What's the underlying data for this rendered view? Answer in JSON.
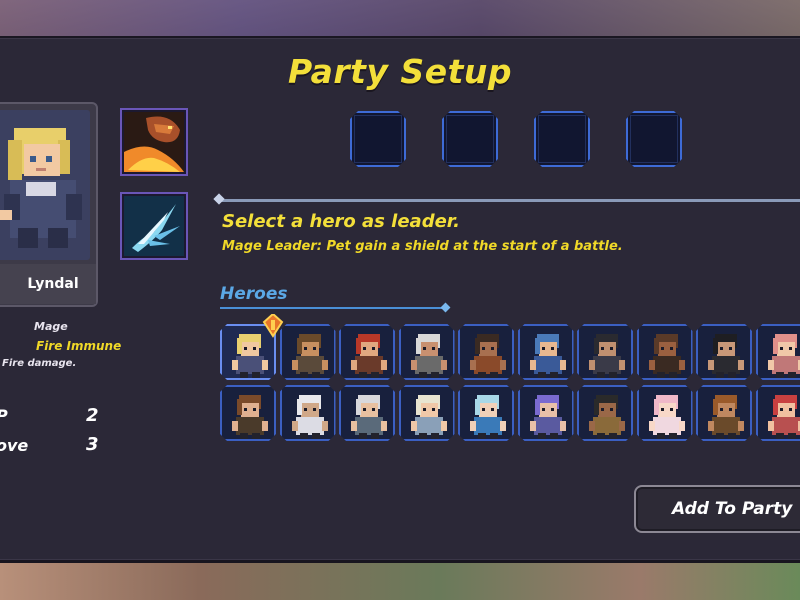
{
  "screen": {
    "title": "Party Setup"
  },
  "selected_hero": {
    "name": "Lyndal",
    "class": "Mage",
    "trait": "Fire Immune",
    "trait_desc": "Fire damage.",
    "stats": [
      {
        "label": "P",
        "value": "2"
      },
      {
        "label": "ove",
        "value": "3"
      }
    ],
    "skills": [
      "dragon-fire-breath-icon",
      "ice-claw-icon"
    ]
  },
  "party": {
    "slots": 4
  },
  "leader": {
    "prompt": "Select a hero as leader.",
    "bonus": "Mage Leader: Pet gain a shield at the start of a battle."
  },
  "heroes": {
    "label": "Heroes",
    "rows": [
      [
        {
          "hair": "#e8d070",
          "skin": "#f0c8a0",
          "body": "#4a5078"
        },
        {
          "hair": "#6a4a2a",
          "skin": "#c89060",
          "body": "#5a4a3a"
        },
        {
          "hair": "#b83828",
          "skin": "#e0a880",
          "body": "#6a3a2a"
        },
        {
          "hair": "#d8d8d8",
          "skin": "#c89070",
          "body": "#6a6a6a"
        },
        {
          "hair": "#3a2a22",
          "skin": "#a87050",
          "body": "#8a4a2a"
        },
        {
          "hair": "#4a7ab8",
          "skin": "#e8b890",
          "body": "#3a5a98"
        },
        {
          "hair": "#2a2a30",
          "skin": "#c09070",
          "body": "#3a3a48"
        },
        {
          "hair": "#5a3a28",
          "skin": "#9a6040",
          "body": "#3a2a22"
        },
        {
          "hair": "#1e1e22",
          "skin": "#c89878",
          "body": "#2a2a30"
        },
        {
          "hair": "#e0908a",
          "skin": "#f0c8a8",
          "body": "#c07878"
        }
      ],
      [
        {
          "hair": "#7a4a2a",
          "skin": "#e0b090",
          "body": "#4a3a2a"
        },
        {
          "hair": "#e8e8ec",
          "skin": "#d0a888",
          "body": "#dcdce4"
        },
        {
          "hair": "#d8d8dc",
          "skin": "#e8c0a0",
          "body": "#5a6a7a"
        },
        {
          "hair": "#e8e4d0",
          "skin": "#f0c8a8",
          "body": "#8aa0b8"
        },
        {
          "hair": "#a8d8e8",
          "skin": "#f0d0b8",
          "body": "#3a7ab8"
        },
        {
          "hair": "#7a6ad0",
          "skin": "#e8c0a8",
          "body": "#5a5aa0"
        },
        {
          "hair": "#2a2a2a",
          "skin": "#9a6848",
          "body": "#8a6a3a"
        },
        {
          "hair": "#f0b8c8",
          "skin": "#f8d8c8",
          "body": "#f0d8e0"
        },
        {
          "hair": "#9a5a2a",
          "skin": "#c08860",
          "body": "#6a4a2a"
        },
        {
          "hair": "#c84040",
          "skin": "#f0c0a0",
          "body": "#b85050"
        }
      ]
    ]
  },
  "actions": {
    "add_to_party": "Add To Party"
  }
}
